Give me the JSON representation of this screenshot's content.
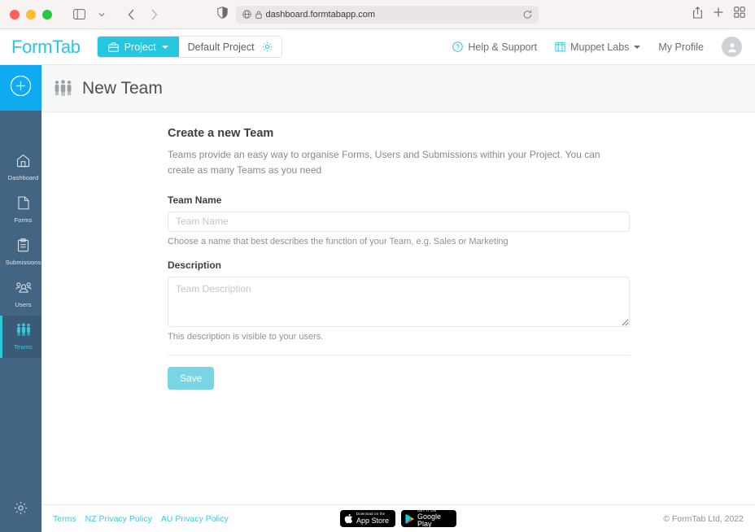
{
  "browser": {
    "url": "dashboard.formtabapp.com",
    "shield_icon": "reader-shield-icon",
    "globe_icon": "globe-icon",
    "lock_icon": "lock-icon",
    "reload_icon": "reload-icon",
    "sidebar_toggle_icon": "sidebar-toggle-icon",
    "back_icon": "back-arrow-icon",
    "forward_icon": "forward-arrow-icon",
    "share_icon": "share-icon",
    "new_tab_icon": "plus-icon",
    "tab_overview_icon": "tab-overview-icon"
  },
  "navbar": {
    "logo": "FormTab",
    "project_button": "Project",
    "project_icon": "briefcase-icon",
    "current_project": "Default Project",
    "project_settings_icon": "gear-icon",
    "help": "Help & Support",
    "help_icon": "question-circle-icon",
    "org": "Muppet Labs",
    "org_icon": "building-icon",
    "profile": "My Profile",
    "avatar_icon": "user-avatar-icon"
  },
  "sidebar": {
    "add_icon": "plus-circle-icon",
    "settings_icon": "gear-icon",
    "items": [
      {
        "label": "Dashboard",
        "icon": "home-icon",
        "active": false
      },
      {
        "label": "Forms",
        "icon": "document-icon",
        "active": false
      },
      {
        "label": "Submissions",
        "icon": "clipboard-icon",
        "active": false
      },
      {
        "label": "Users",
        "icon": "users-icon",
        "active": false
      },
      {
        "label": "Teams",
        "icon": "teams-icon",
        "active": true
      }
    ]
  },
  "page": {
    "title": "New Team",
    "title_icon": "teams-icon"
  },
  "form": {
    "heading": "Create a new Team",
    "description": "Teams provide an easy way to organise Forms, Users and Submissions within your Project. You can create as many Teams as you need",
    "name_label": "Team Name",
    "name_value": "",
    "name_placeholder": "Team Name",
    "name_help": "Choose a name that best describes the function of your Team, e.g. Sales or Marketing",
    "description_label": "Description",
    "description_value": "",
    "description_placeholder": "Team Description",
    "description_help": "This description is visible to your users.",
    "save_label": "Save"
  },
  "footer": {
    "links": [
      "Terms",
      "NZ Privacy Policy",
      "AU Privacy Policy"
    ],
    "appstore_small": "Download on the",
    "appstore_big": "App Store",
    "googleplay_small": "GET IT ON",
    "googleplay_big": "Google Play",
    "copyright": "© FormTab Ltd, 2022"
  },
  "colors": {
    "accent_teal": "#2ec7e0",
    "sidebar": "#436584",
    "add_blue": "#0faaf0",
    "save_button": "#79d5e3"
  }
}
